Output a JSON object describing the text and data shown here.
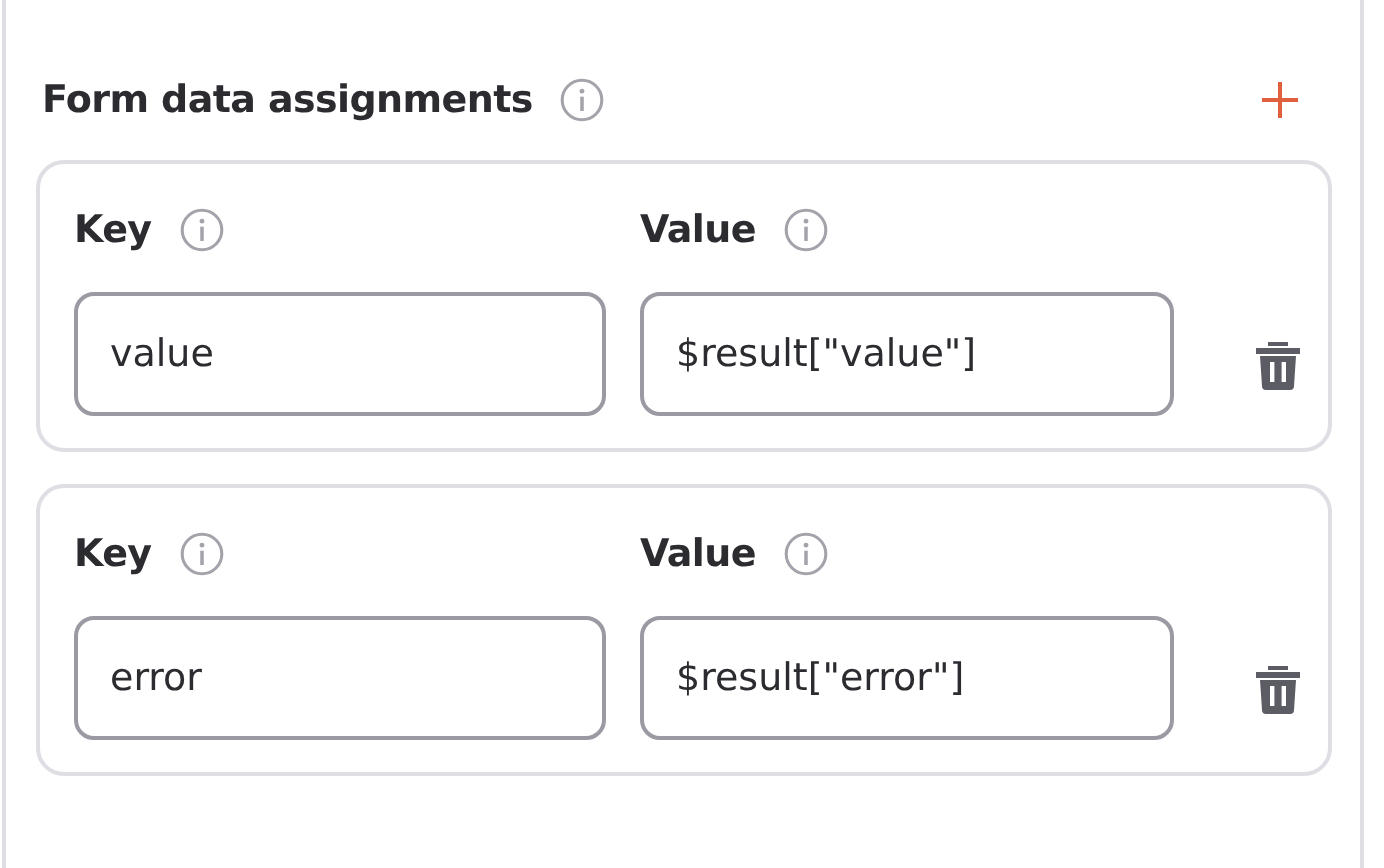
{
  "section": {
    "title": "Form data assignments"
  },
  "assignments": [
    {
      "key_label": "Key",
      "value_label": "Value",
      "key": "value",
      "value": "$result[\"value\"]"
    },
    {
      "key_label": "Key",
      "value_label": "Value",
      "key": "error",
      "value": "$result[\"error\"]"
    }
  ]
}
